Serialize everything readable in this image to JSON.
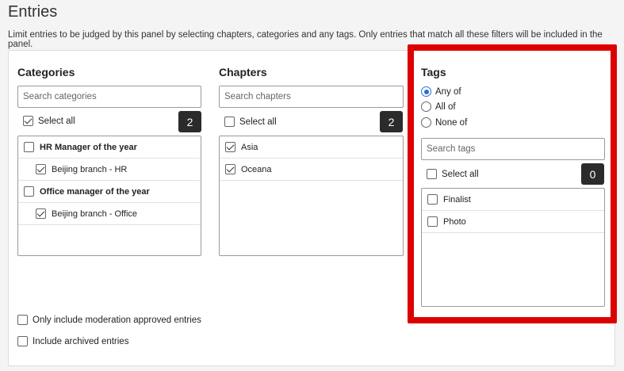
{
  "page": {
    "title": "Entries",
    "description": "Limit entries to be judged by this panel by selecting chapters, categories and any tags. Only entries that match all these filters will be included in the panel."
  },
  "categories": {
    "title": "Categories",
    "search_placeholder": "Search categories",
    "select_all_label": "Select all",
    "count": "2",
    "items": [
      {
        "label": "HR Manager of the year",
        "checked": false,
        "bold": true,
        "indent": false
      },
      {
        "label": "Beijing branch - HR",
        "checked": true,
        "bold": false,
        "indent": true
      },
      {
        "label": "Office manager of the year",
        "checked": false,
        "bold": true,
        "indent": false
      },
      {
        "label": "Beijing branch - Office",
        "checked": true,
        "bold": false,
        "indent": true
      }
    ]
  },
  "chapters": {
    "title": "Chapters",
    "search_placeholder": "Search chapters",
    "select_all_label": "Select all",
    "count": "2",
    "items": [
      {
        "label": "Asia",
        "checked": true
      },
      {
        "label": "Oceana",
        "checked": true
      }
    ]
  },
  "tags": {
    "title": "Tags",
    "match_options": [
      {
        "label": "Any of",
        "selected": true
      },
      {
        "label": "All of",
        "selected": false
      },
      {
        "label": "None of",
        "selected": false
      }
    ],
    "search_placeholder": "Search tags",
    "select_all_label": "Select all",
    "count": "0",
    "items": [
      {
        "label": "Finalist",
        "checked": false
      },
      {
        "label": "Photo",
        "checked": false
      }
    ]
  },
  "options": {
    "moderation_label": "Only include moderation approved entries",
    "archived_label": "Include archived entries"
  },
  "colors": {
    "highlight": "#dd0000",
    "radio_accent": "#2b6cd9",
    "count_badge": "#2b2b2b"
  }
}
